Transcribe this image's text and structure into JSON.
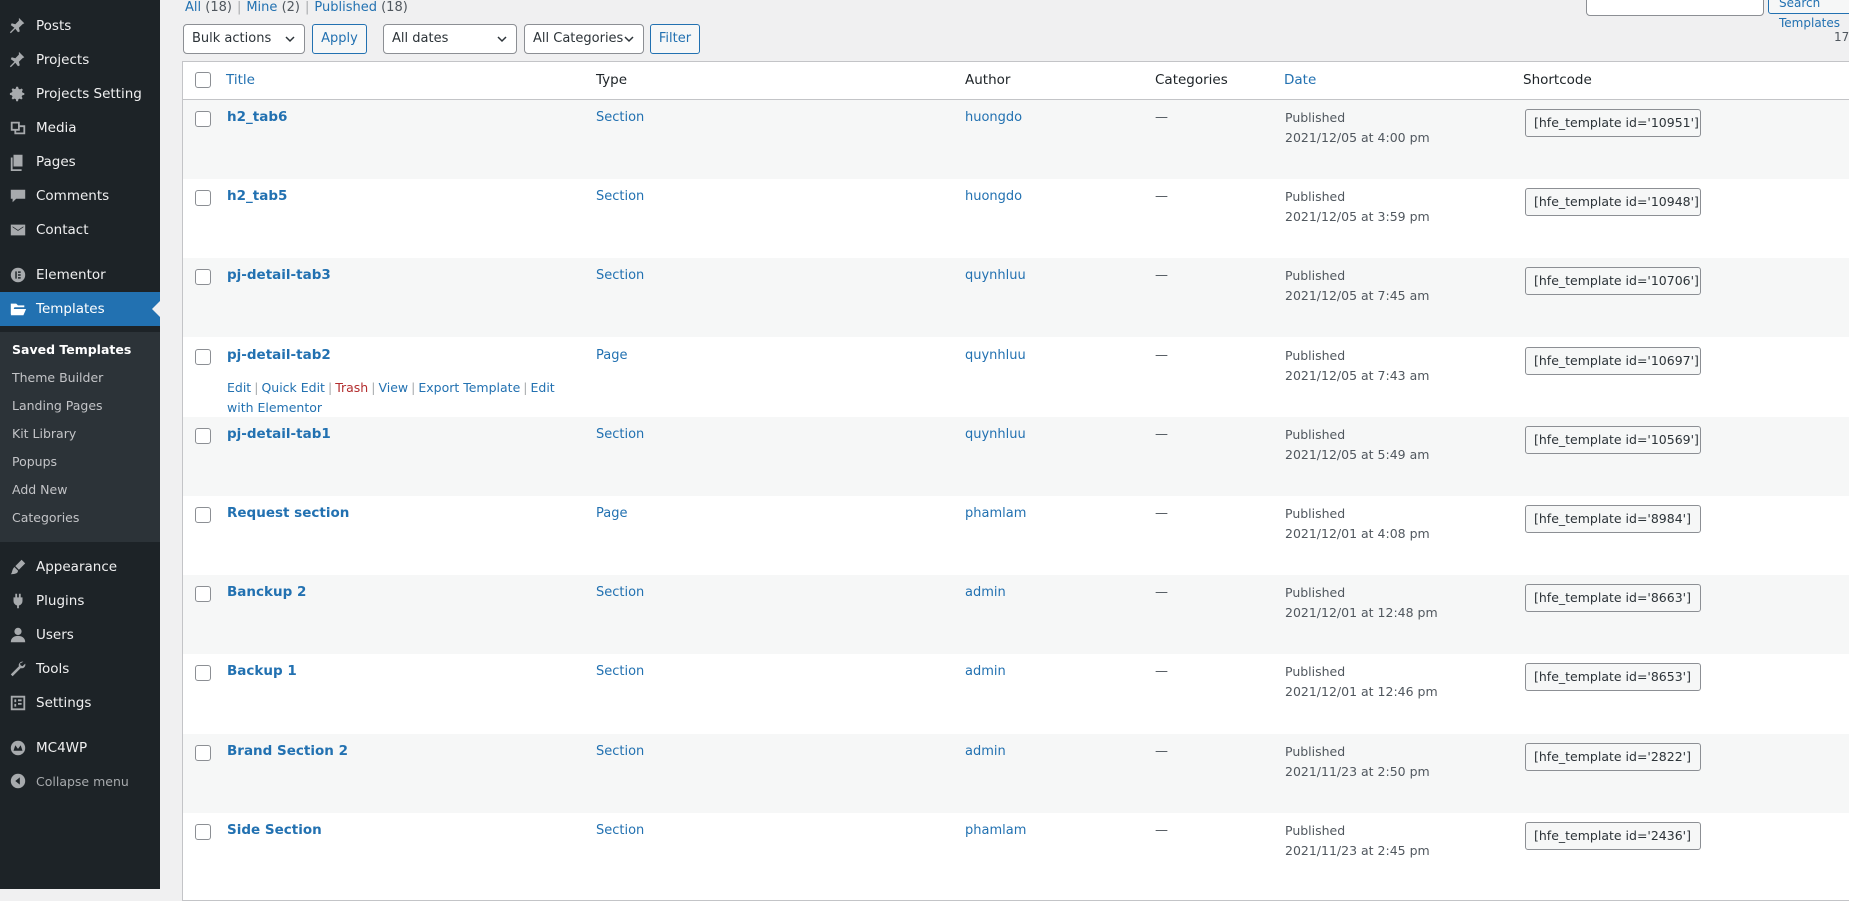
{
  "sidebar": {
    "items": [
      {
        "label": "Posts",
        "icon": "pushpin-icon",
        "name": "posts"
      },
      {
        "label": "Projects",
        "icon": "pushpin-icon",
        "name": "projects"
      },
      {
        "label": "Projects Setting",
        "icon": "gear-icon",
        "name": "projects-setting"
      },
      {
        "label": "Media",
        "icon": "media-icon",
        "name": "media"
      },
      {
        "label": "Pages",
        "icon": "pages-icon",
        "name": "pages"
      },
      {
        "label": "Comments",
        "icon": "comment-icon",
        "name": "comments"
      },
      {
        "label": "Contact",
        "icon": "mail-icon",
        "name": "contact"
      },
      {
        "label": "Elementor",
        "icon": "elementor-icon",
        "name": "elementor"
      },
      {
        "label": "Templates",
        "icon": "folder-icon",
        "name": "templates"
      },
      {
        "label": "Appearance",
        "icon": "brush-icon",
        "name": "appearance"
      },
      {
        "label": "Plugins",
        "icon": "plug-icon",
        "name": "plugins"
      },
      {
        "label": "Users",
        "icon": "user-icon",
        "name": "users"
      },
      {
        "label": "Tools",
        "icon": "wrench-icon",
        "name": "tools"
      },
      {
        "label": "Settings",
        "icon": "settings-icon",
        "name": "settings"
      },
      {
        "label": "MC4WP",
        "icon": "mc4wp-icon",
        "name": "mc4wp"
      },
      {
        "label": "Collapse menu",
        "icon": "collapse-icon",
        "name": "collapse-menu"
      }
    ],
    "submenu": [
      "Saved Templates",
      "Theme Builder",
      "Landing Pages",
      "Kit Library",
      "Popups",
      "Add New",
      "Categories"
    ]
  },
  "views": {
    "all": "All",
    "all_count": "(18)",
    "mine": "Mine",
    "mine_count": "(2)",
    "published": "Published",
    "published_count": "(18)",
    "sep": "|"
  },
  "toolbar": {
    "bulk_actions": "Bulk actions",
    "apply": "Apply",
    "dates": "All dates",
    "categories": "All Categories",
    "filter": "Filter",
    "search_button": "Search Templates",
    "search_value": "",
    "items_count": "17"
  },
  "columns": {
    "title": "Title",
    "type": "Type",
    "author": "Author",
    "categories": "Categories",
    "date": "Date",
    "shortcode": "Shortcode"
  },
  "row_actions": {
    "edit": "Edit",
    "quick_edit": "Quick Edit",
    "trash": "Trash",
    "view": "View",
    "export": "Export Template",
    "edit_with": "Edit with Elementor",
    "sep": "|"
  },
  "rows": [
    {
      "title": "h2_tab6",
      "type": "Section",
      "author": "huongdo",
      "categories": "—",
      "status": "Published",
      "date": "2021/12/05 at 4:00 pm",
      "shortcode": "[hfe_template id='10951']"
    },
    {
      "title": "h2_tab5",
      "type": "Section",
      "author": "huongdo",
      "categories": "—",
      "status": "Published",
      "date": "2021/12/05 at 3:59 pm",
      "shortcode": "[hfe_template id='10948']"
    },
    {
      "title": "pj-detail-tab3",
      "type": "Section",
      "author": "quynhluu",
      "categories": "—",
      "status": "Published",
      "date": "2021/12/05 at 7:45 am",
      "shortcode": "[hfe_template id='10706']"
    },
    {
      "title": "pj-detail-tab2",
      "type": "Page",
      "author": "quynhluu",
      "categories": "—",
      "status": "Published",
      "date": "2021/12/05 at 7:43 am",
      "shortcode": "[hfe_template id='10697']"
    },
    {
      "title": "pj-detail-tab1",
      "type": "Section",
      "author": "quynhluu",
      "categories": "—",
      "status": "Published",
      "date": "2021/12/05 at 5:49 am",
      "shortcode": "[hfe_template id='10569']"
    },
    {
      "title": "Request section",
      "type": "Page",
      "author": "phamlam",
      "categories": "—",
      "status": "Published",
      "date": "2021/12/01 at 4:08 pm",
      "shortcode": "[hfe_template id='8984']"
    },
    {
      "title": "Banckup 2",
      "type": "Section",
      "author": "admin",
      "categories": "—",
      "status": "Published",
      "date": "2021/12/01 at 12:48 pm",
      "shortcode": "[hfe_template id='8663']"
    },
    {
      "title": "Backup 1",
      "type": "Section",
      "author": "admin",
      "categories": "—",
      "status": "Published",
      "date": "2021/12/01 at 12:46 pm",
      "shortcode": "[hfe_template id='8653']"
    },
    {
      "title": "Brand Section 2",
      "type": "Section",
      "author": "admin",
      "categories": "—",
      "status": "Published",
      "date": "2021/11/23 at 2:50 pm",
      "shortcode": "[hfe_template id='2822']"
    },
    {
      "title": "Side Section",
      "type": "Section",
      "author": "phamlam",
      "categories": "—",
      "status": "Published",
      "date": "2021/11/23 at 2:45 pm",
      "shortcode": "[hfe_template id='2436']"
    }
  ],
  "colors": {
    "sidebar_bg": "#1d2327",
    "accent": "#2271b1",
    "trash": "#b32d2e"
  }
}
